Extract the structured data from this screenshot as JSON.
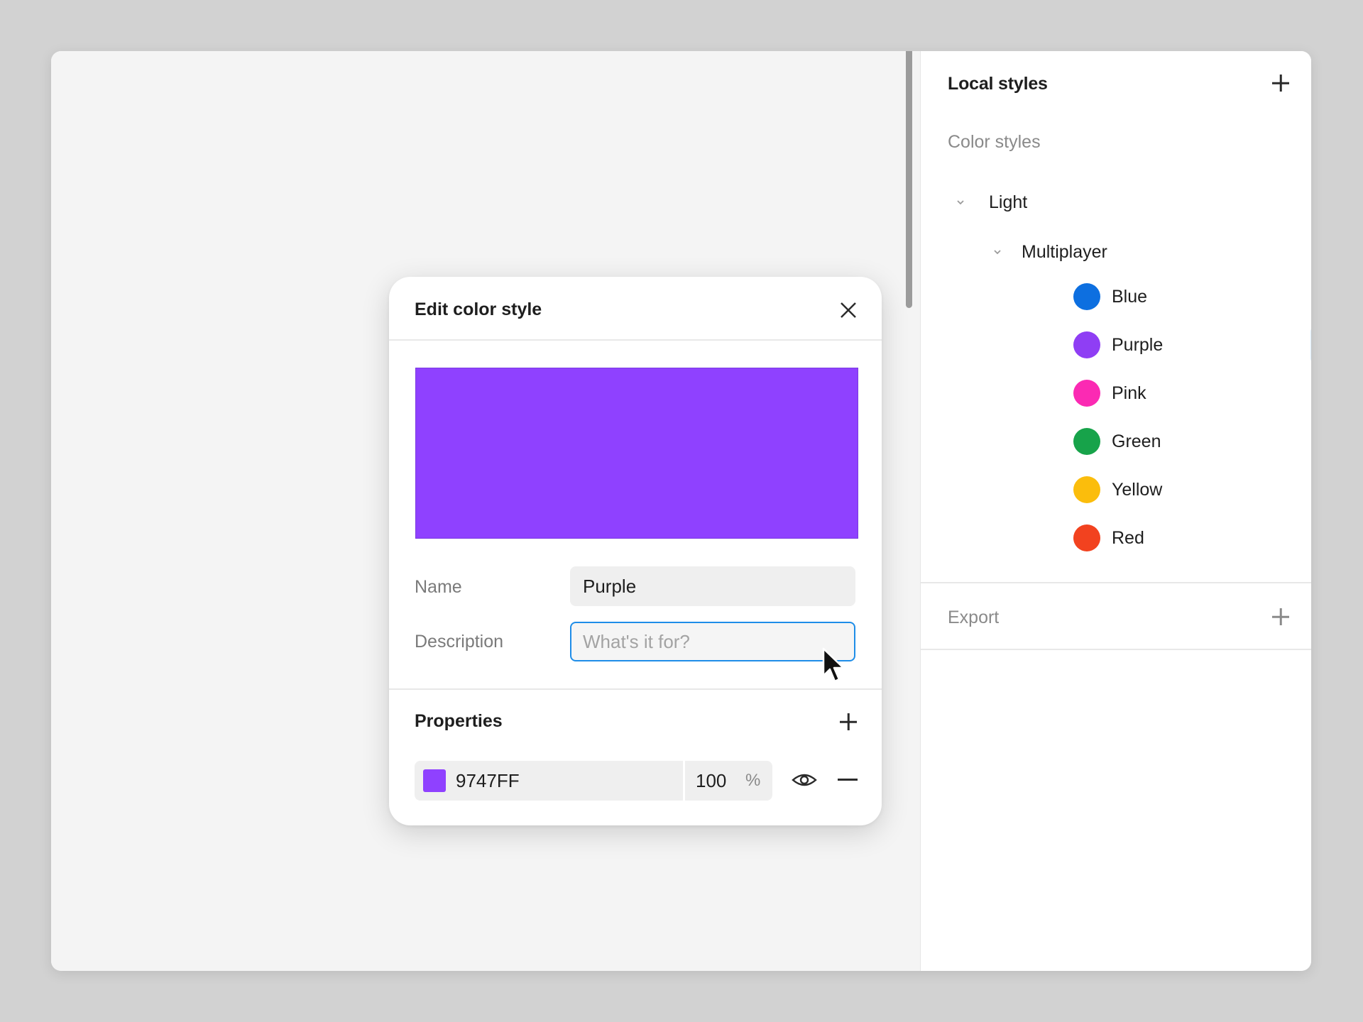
{
  "panel": {
    "title": "Local styles",
    "add_icon": "plus-icon",
    "section_label": "Color styles",
    "groups": [
      {
        "label": "Light",
        "subgroups": [
          {
            "label": "Multiplayer",
            "colors": [
              {
                "name": "Blue",
                "color": "#0d6fe0"
              },
              {
                "name": "Purple",
                "color": "#8f3ef4"
              },
              {
                "name": "Pink",
                "color": "#fb2ab3"
              },
              {
                "name": "Green",
                "color": "#17a34a"
              },
              {
                "name": "Yellow",
                "color": "#fbbd0c"
              },
              {
                "name": "Red",
                "color": "#f2421f"
              }
            ]
          }
        ]
      }
    ],
    "selected_style": "Purple",
    "adjust_icon": "adjust-icon",
    "export_label": "Export"
  },
  "dialog": {
    "title": "Edit color style",
    "close_icon": "close-icon",
    "preview_color": "#8f41ff",
    "name_label": "Name",
    "name_value": "Purple",
    "description_label": "Description",
    "description_placeholder": "What's it for?",
    "properties_title": "Properties",
    "fill": {
      "hex": "9747FF",
      "opacity": "100",
      "unit": "%",
      "swatch_color": "#8f41ff"
    }
  },
  "accent_color": "#1e8de8"
}
